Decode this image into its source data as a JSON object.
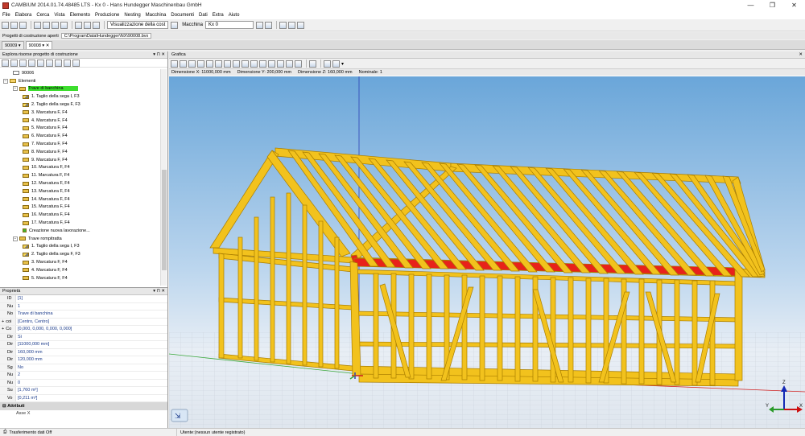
{
  "window": {
    "title": "CAMBIUM 2014.01.74.48485 LTS - Kx 0 - Hans Hundegger Maschinenbau GmbH",
    "controls": [
      "—",
      "❐",
      "✕"
    ]
  },
  "menu": [
    "File",
    "Elabora",
    "Cerca",
    "Vista",
    "Elemento",
    "Produzione",
    "Nesting",
    "Macchina",
    "Documenti",
    "Dati",
    "Extra",
    "Aiuto"
  ],
  "toolbar": {
    "view_select": "Visualizzazione della cost",
    "machine_label": "Macchina",
    "machine_value": "Kx 0"
  },
  "projects_bar": {
    "label": "Progetti di costruzione aperti",
    "path": "C:\\ProgramData\\Hundegger\\NX\\90008.bvx"
  },
  "doc_tabs": [
    "90009",
    "90008"
  ],
  "explorer": {
    "title": "Esplora risorse progetto di costruzione",
    "rows": [
      {
        "label": "90006",
        "indent": 1,
        "icon": "doc"
      },
      {
        "label": "Elementi",
        "indent": 0,
        "icon": "folder",
        "expander": "−"
      },
      {
        "label": "Trave di banchina",
        "indent": 1,
        "icon": "beam",
        "expander": "−",
        "selected": true
      },
      {
        "label": "1. Taglio della sega I, F3",
        "indent": 2,
        "icon": "op"
      },
      {
        "label": "2. Taglio della sega F, F3",
        "indent": 2,
        "icon": "op"
      },
      {
        "label": "3. Marcatura F, F4",
        "indent": 2,
        "icon": "beam"
      },
      {
        "label": "4. Marcatura F, F4",
        "indent": 2,
        "icon": "beam"
      },
      {
        "label": "5. Marcatura F, F4",
        "indent": 2,
        "icon": "beam"
      },
      {
        "label": "6. Marcatura F, F4",
        "indent": 2,
        "icon": "beam"
      },
      {
        "label": "7. Marcatura F, F4",
        "indent": 2,
        "icon": "beam"
      },
      {
        "label": "8. Marcatura F, F4",
        "indent": 2,
        "icon": "beam"
      },
      {
        "label": "9. Marcatura F, F4",
        "indent": 2,
        "icon": "beam"
      },
      {
        "label": "10. Marcatura F, F4",
        "indent": 2,
        "icon": "beam"
      },
      {
        "label": "11. Marcatura F, F4",
        "indent": 2,
        "icon": "beam"
      },
      {
        "label": "12. Marcatura F, F4",
        "indent": 2,
        "icon": "beam"
      },
      {
        "label": "13. Marcatura F, F4",
        "indent": 2,
        "icon": "beam"
      },
      {
        "label": "14. Marcatura F, F4",
        "indent": 2,
        "icon": "beam"
      },
      {
        "label": "15. Marcatura F, F4",
        "indent": 2,
        "icon": "beam"
      },
      {
        "label": "16. Marcatura F, F4",
        "indent": 2,
        "icon": "beam"
      },
      {
        "label": "17. Marcatura F, F4",
        "indent": 2,
        "icon": "beam"
      },
      {
        "label": "Creazione nuova lavorazione...",
        "indent": 2,
        "icon": "add"
      },
      {
        "label": "Trave rompitratta",
        "indent": 1,
        "icon": "beam",
        "expander": "−"
      },
      {
        "label": "1. Taglio della sega I, F3",
        "indent": 2,
        "icon": "op"
      },
      {
        "label": "2. Taglio della sega F, F3",
        "indent": 2,
        "icon": "op"
      },
      {
        "label": "3. Marcatura F, F4",
        "indent": 2,
        "icon": "beam"
      },
      {
        "label": "4. Marcatura F, F4",
        "indent": 2,
        "icon": "beam"
      },
      {
        "label": "5. Marcatura F, F4",
        "indent": 2,
        "icon": "beam"
      }
    ]
  },
  "properties": {
    "title": "Proprietà",
    "rows": [
      {
        "key": "ID",
        "value": "[1]"
      },
      {
        "key": "Nu",
        "value": "1"
      },
      {
        "key": "No",
        "value": "Trave di banchina"
      },
      {
        "key": "coi",
        "value": "[Centro, Centro]",
        "expander": "+"
      },
      {
        "key": "Co",
        "value": "[0,000, 0,000, 0,000, 0,000]",
        "expander": "+"
      },
      {
        "key": "Dir",
        "value": "Sì"
      },
      {
        "key": "Dir",
        "value": "[11000,000 mm]"
      },
      {
        "key": "Dir",
        "value": "160,000 mm"
      },
      {
        "key": "Dir",
        "value": "120,000 mm"
      },
      {
        "key": "Sg",
        "value": "No"
      },
      {
        "key": "Nu",
        "value": "2"
      },
      {
        "key": "Nu",
        "value": "0"
      },
      {
        "key": "Su",
        "value": "[1,760 m²]"
      },
      {
        "key": "Vo",
        "value": "[0,211 m³]"
      }
    ],
    "group": "Attributi",
    "footer_row": "Asse X"
  },
  "graphics": {
    "title": "Grafica",
    "info": [
      "Dimensione X: 11000,000 mm",
      "Dimensione Y: 200,000 mm",
      "Dimensione Z: 160,000 mm",
      "Nominale: 1"
    ]
  },
  "axes": {
    "x": "X",
    "y": "Y",
    "z": "Z"
  },
  "status": {
    "transfer": "Trasferimento dati Off",
    "user": "Utente:(nessun utente registrato)"
  },
  "colors": {
    "selection": "#3dde2e",
    "timber": "#f2c21d",
    "highlight_beam": "#e8221a"
  }
}
